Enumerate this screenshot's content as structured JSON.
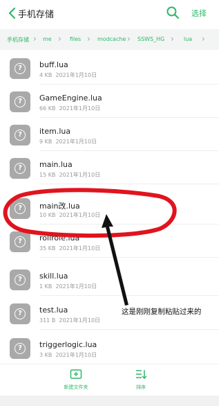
{
  "header": {
    "title": "手机存储",
    "select_label": "选择"
  },
  "breadcrumb": [
    "手机存储",
    "me",
    "files",
    "modcache",
    "SSWS_HG",
    "lua"
  ],
  "files": [
    {
      "name": "buff.lua",
      "size": "4 KB",
      "date": "2021年1月10日"
    },
    {
      "name": "GameEngine.lua",
      "size": "66 KB",
      "date": "2021年1月10日"
    },
    {
      "name": "item.lua",
      "size": "9 KB",
      "date": "2021年1月10日"
    },
    {
      "name": "main.lua",
      "size": "15 KB",
      "date": "2021年1月10日"
    },
    {
      "name": "main改.lua",
      "size": "10 KB",
      "date": "2021年1月10日"
    },
    {
      "name": "rollrole.lua",
      "size": "35 KB",
      "date": "2021年1月10日"
    },
    {
      "name": "skill.lua",
      "size": "1 KB",
      "date": "2021年1月10日"
    },
    {
      "name": "test.lua",
      "size": "311 B",
      "date": "2021年1月10日"
    },
    {
      "name": "triggerlogic.lua",
      "size": "3 KB",
      "date": "2021年1月10日"
    }
  ],
  "bottom_bar": {
    "new_folder_label": "新建文件夹",
    "sort_label": "排序"
  },
  "annotation": {
    "text": "这是刚刚复制粘贴过来的",
    "color": "#e0141e"
  },
  "colors": {
    "accent": "#2fb66a",
    "file_icon": "#a9a9a9"
  },
  "icons": {
    "back": "chevron-left-icon",
    "search": "search-icon",
    "new_folder": "new-folder-icon",
    "sort": "sort-icon"
  }
}
